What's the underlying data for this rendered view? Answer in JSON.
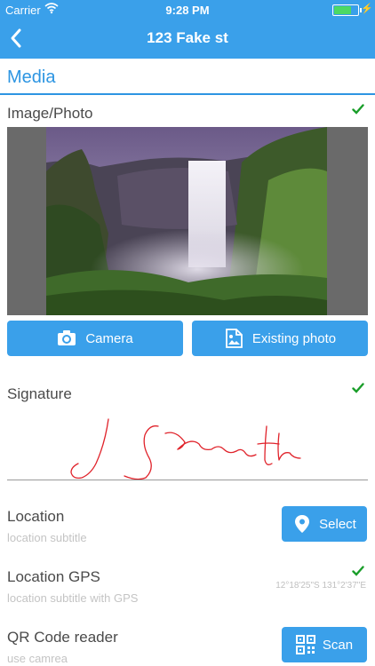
{
  "status_bar": {
    "carrier": "Carrier",
    "time": "9:28 PM"
  },
  "nav": {
    "title": "123 Fake st",
    "back_icon": "chevron-left-icon"
  },
  "section": {
    "title": "Media"
  },
  "image_photo": {
    "label": "Image/Photo",
    "camera_label": "Camera",
    "existing_label": "Existing photo"
  },
  "signature": {
    "label": "Signature"
  },
  "location": {
    "label": "Location",
    "subtitle": "location subtitle",
    "button_label": "Select"
  },
  "location_gps": {
    "label": "Location GPS",
    "subtitle": "location subtitle with GPS",
    "coordinates": "12°18'25\"S 131°2'37\"E"
  },
  "qr": {
    "label": "QR Code reader",
    "subtitle": "use camrea",
    "button_label": "Scan"
  },
  "colors": {
    "accent": "#3aa0ea",
    "check": "#1a9e2a",
    "signature_ink": "#e0232b"
  }
}
